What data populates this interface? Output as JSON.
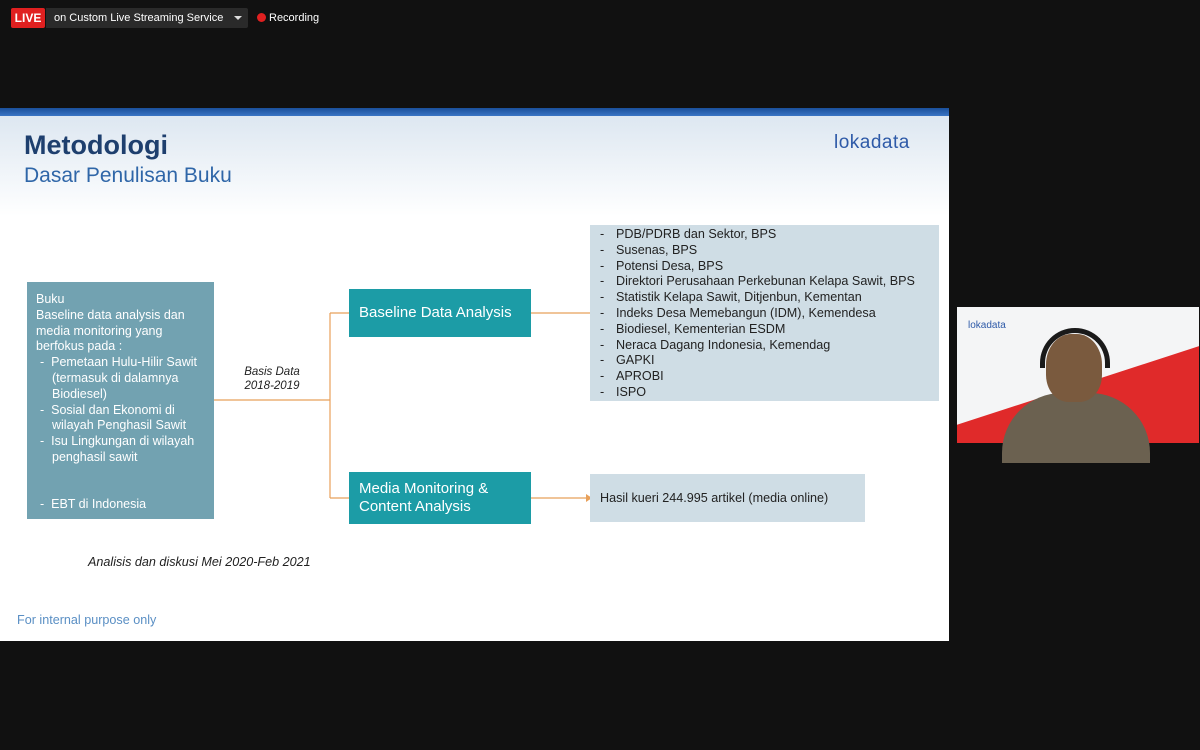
{
  "toolbar": {
    "live_label": "LIVE",
    "stream_label": "on Custom Live Streaming Service",
    "recording_label": "Recording"
  },
  "slide": {
    "title": "Metodologi",
    "subtitle": "Dasar Penulisan Buku",
    "logo": "lokadata",
    "left_box": {
      "heading": "Buku",
      "intro": "Baseline data analysis dan media monitoring yang berfokus pada :",
      "items": [
        "Pemetaan Hulu-Hilir Sawit (termasuk di dalamnya Biodiesel)",
        "Sosial dan Ekonomi di wilayah Penghasil Sawit",
        "Isu Lingkungan di wilayah penghasil sawit",
        "EBT di Indonesia"
      ]
    },
    "basis_label": "Basis Data 2018-2019",
    "baseline_label": "Baseline Data Analysis",
    "media_label": "Media Monitoring & Content Analysis",
    "sources": [
      "PDB/PDRB dan Sektor, BPS",
      "Susenas, BPS",
      "Potensi Desa, BPS",
      "Direktori Perusahaan Perkebunan Kelapa Sawit, BPS",
      "Statistik Kelapa Sawit, Ditjenbun, Kementan",
      "Indeks Desa Memebangun (IDM), Kemendesa",
      "Biodiesel, Kementerian ESDM",
      "Neraca Dagang Indonesia, Kemendag",
      "GAPKI",
      "APROBI",
      "ISPO"
    ],
    "media_result": "Hasil kueri 244.995 artikel (media online)",
    "analysis_note": "Analisis dan diskusi Mei 2020-Feb 2021",
    "footer": "For internal purpose only"
  },
  "camera": {
    "logo": "lokadata"
  },
  "colors": {
    "live_red": "#e02020",
    "slide_title": "#1e3f6e",
    "teal_box": "#1c9ca6",
    "left_box": "#72a2b1",
    "source_box": "#cfdde5",
    "connector": "#e8a05a"
  }
}
